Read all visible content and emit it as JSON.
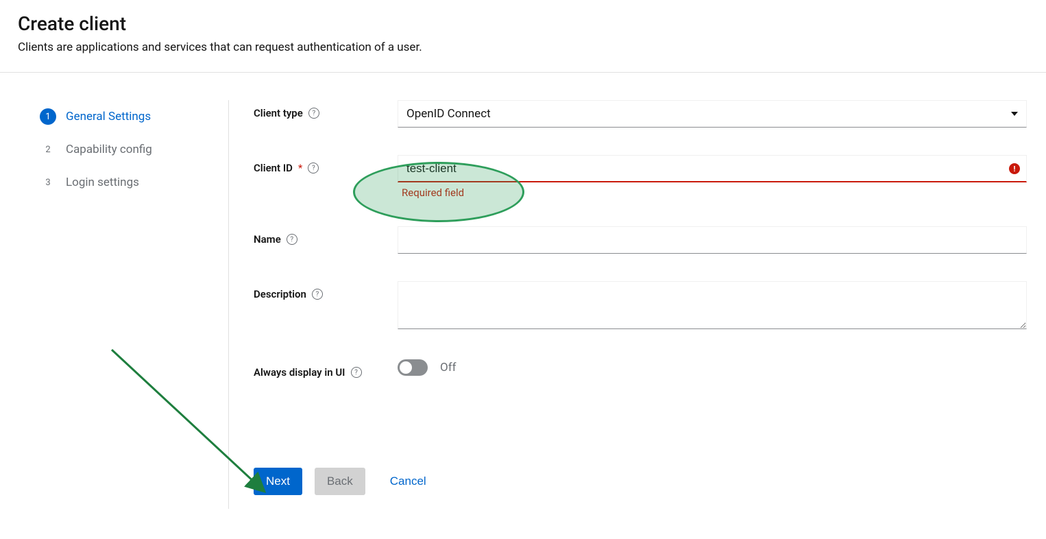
{
  "header": {
    "title": "Create client",
    "description": "Clients are applications and services that can request authentication of a user."
  },
  "stepper": {
    "steps": [
      {
        "num": "1",
        "label": "General Settings",
        "active": true
      },
      {
        "num": "2",
        "label": "Capability config",
        "active": false
      },
      {
        "num": "3",
        "label": "Login settings",
        "active": false
      }
    ]
  },
  "form": {
    "client_type": {
      "label": "Client type",
      "value": "OpenID Connect"
    },
    "client_id": {
      "label": "Client ID",
      "value": "test-client",
      "error_message": "Required field"
    },
    "name": {
      "label": "Name",
      "value": ""
    },
    "description": {
      "label": "Description",
      "value": ""
    },
    "always_display": {
      "label": "Always display in UI",
      "state_label": "Off"
    }
  },
  "buttons": {
    "next": "Next",
    "back": "Back",
    "cancel": "Cancel"
  },
  "help_glyph": "?",
  "error_glyph": "!"
}
